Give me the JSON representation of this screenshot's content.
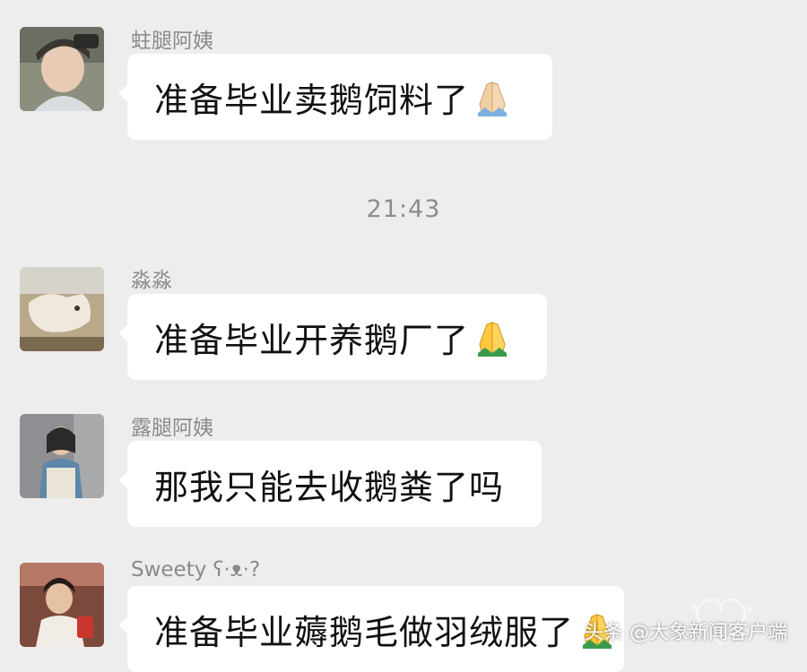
{
  "timestamp": "21:43",
  "messages": [
    {
      "sender": "蛀腿阿姨",
      "text": "准备毕业卖鹅饲料了",
      "emoji": "folded-hands",
      "emoji_tone": "#f2cfa0"
    },
    {
      "sender": "淼淼",
      "text": "准备毕业开养鹅厂了",
      "emoji": "folded-hands",
      "emoji_tone": "#ffc83d"
    },
    {
      "sender": "露腿阿姨",
      "text": "那我只能去收鹅粪了吗",
      "emoji": "",
      "emoji_tone": ""
    },
    {
      "sender": "Sweety ʕ·ᴥ·?",
      "text": "准备毕业薅鹅毛做羽绒服了",
      "emoji": "folded-hands",
      "emoji_tone": "#ffc83d"
    }
  ],
  "watermark": "头条 @大象新闻客户端",
  "colors": {
    "background": "#ededed",
    "bubble": "#ffffff",
    "sender_name": "#8a8a8a",
    "timestamp": "#8d8d8d"
  }
}
